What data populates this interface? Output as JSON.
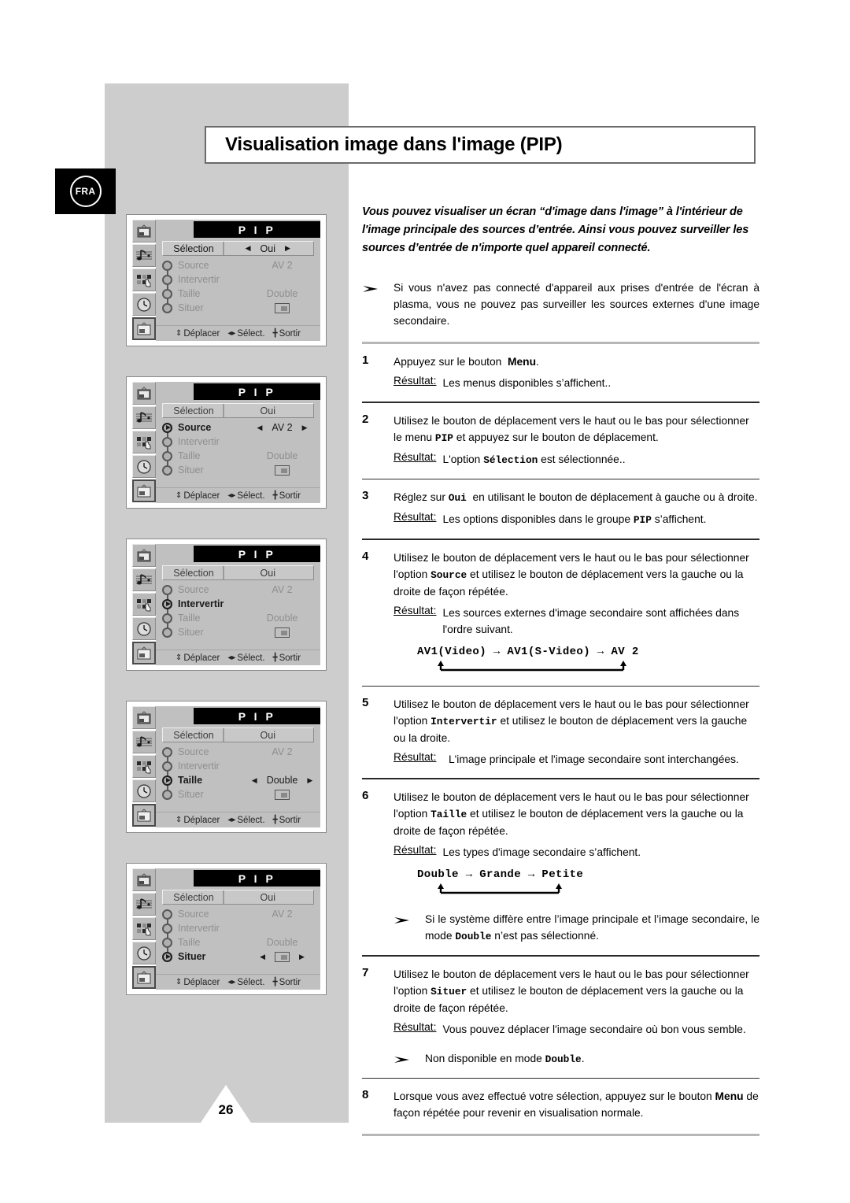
{
  "page": {
    "title": "Visualisation image dans l'image (PIP)",
    "language_badge": "FRA",
    "number": "26"
  },
  "intro": "Vous pouvez visualiser un écran “d'image dans l'image” à l'intérieur de l'image principale des sources d’entrée. Ainsi vous pouvez surveiller les sources d’entrée de n'importe quel appareil connecté.",
  "top_note": "Si vous n'avez pas connecté d'appareil aux prises d'entrée de l'écran à plasma, vous ne pouvez pas surveiller les sources externes d'une image secondaire.",
  "labels": {
    "result": "Résultat:",
    "arrow_icon": "arrowhead-bullet-icon"
  },
  "steps": [
    {
      "num": "1",
      "text_parts": [
        "Appuyez sur le bouton  ",
        "Menu",
        "."
      ],
      "text": "Appuyez sur le bouton  Menu.",
      "result": "Les menus disponibles s’affichent.."
    },
    {
      "num": "2",
      "text": "Utilisez le bouton de déplacement vers le haut ou le bas pour sélectionner le menu PIP et appuyez sur le bouton de déplacement.",
      "result": "L'option Sélection est sélectionnée.."
    },
    {
      "num": "3",
      "text": "Réglez sur Oui  en utilisant le bouton de déplacement à gauche ou à droite.",
      "result": "Les options disponibles dans le groupe PIP s’affichent."
    },
    {
      "num": "4",
      "text": "Utilisez le bouton de déplacement vers le haut ou le bas pour sélectionner l'option Source et utilisez le bouton de déplacement vers la gauche ou la droite de façon répétée.",
      "result": "Les sources externes d'image secondaire sont affichées dans l'ordre suivant.",
      "sequence": "AV1(Video) → AV1(S-Video) → AV 2"
    },
    {
      "num": "5",
      "text": "Utilisez le bouton de déplacement vers le haut ou le bas pour sélectionner l'option Intervertir et utilisez le bouton de déplacement vers la gauche ou la droite.",
      "result": "L'image principale et l'image secondaire sont interchangées."
    },
    {
      "num": "6",
      "text": "Utilisez le bouton de déplacement vers le haut ou le bas pour sélectionner l'option Taille et utilisez le bouton de déplacement vers la gauche ou la droite de façon répétée.",
      "result": "Les types d'image secondaire s’affichent.",
      "sequence": "Double → Grande → Petite",
      "note": "Si le système diffère entre l’image principale et l’image secondaire, le mode Double n’est pas sélectionné."
    },
    {
      "num": "7",
      "text": "Utilisez le bouton de déplacement vers le haut ou le bas pour sélectionner l'option Situer et utilisez le bouton de déplacement vers la gauche ou la droite de façon répétée.",
      "result": "Vous pouvez déplacer l'image secondaire où bon vous semble.",
      "note": "Non disponible en mode Double."
    },
    {
      "num": "8",
      "text": "Lorsque vous avez effectué votre sélection, appuyez sur le bouton Menu de façon répétée pour revenir en visualisation normale."
    }
  ],
  "osd": {
    "title": "P I P",
    "footer": [
      {
        "glyph": "updown-arrows-icon",
        "label": "Déplacer"
      },
      {
        "glyph": "leftright-arrows-icon",
        "label": "Sélect."
      },
      {
        "glyph": "menu-bars-icon",
        "label": "Sortir"
      }
    ],
    "sidebar_icons": [
      "tv-picture-icon",
      "music-note-icon",
      "feature-mosaic-icon",
      "clock-icon",
      "pip-screen-icon"
    ],
    "selection_label": "Sélection",
    "selection_value": "Oui",
    "rows": [
      {
        "name": "Source",
        "value": "AV 2"
      },
      {
        "name": "Intervertir",
        "value": ""
      },
      {
        "name": "Taille",
        "value": "Double"
      },
      {
        "name": "Situer",
        "value": "position-icon"
      }
    ],
    "screens": [
      {
        "focus": "selection",
        "arrows_on": "selection"
      },
      {
        "focus": "Source",
        "arrows_on": "Source"
      },
      {
        "focus": "Intervertir",
        "arrows_on": ""
      },
      {
        "focus": "Taille",
        "arrows_on": "Taille"
      },
      {
        "focus": "Situer",
        "arrows_on": "Situer"
      }
    ]
  }
}
